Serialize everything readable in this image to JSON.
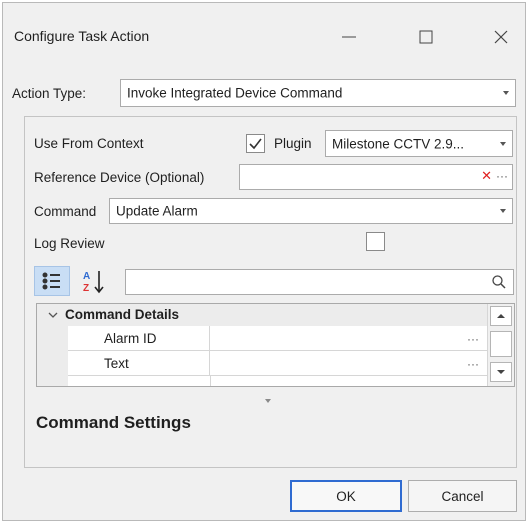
{
  "window": {
    "title": "Configure Task Action",
    "minimize_icon": "minimize-icon",
    "maximize_icon": "maximize-icon",
    "close_icon": "close-icon"
  },
  "action_type": {
    "label": "Action Type:",
    "value": "Invoke Integrated Device Command"
  },
  "use_from_context": {
    "label": "Use From Context",
    "checked": true,
    "plugin_label": "Plugin",
    "plugin_value": "Milestone CCTV 2.9..."
  },
  "reference_device": {
    "label": "Reference Device (Optional)",
    "value": ""
  },
  "command": {
    "label": "Command",
    "value": "Update Alarm"
  },
  "log_review": {
    "label": "Log Review",
    "checked": false
  },
  "property_grid": {
    "search_value": "",
    "category": "Command Details",
    "rows": [
      {
        "name": "Alarm ID",
        "value": ""
      },
      {
        "name": "Text",
        "value": ""
      }
    ]
  },
  "settings": {
    "title": "Command Settings"
  },
  "buttons": {
    "ok": "OK",
    "cancel": "Cancel"
  },
  "colors": {
    "window_bg": "#f0f0f0",
    "accent": "#2f6bd1",
    "clear_x": "#e02020"
  }
}
